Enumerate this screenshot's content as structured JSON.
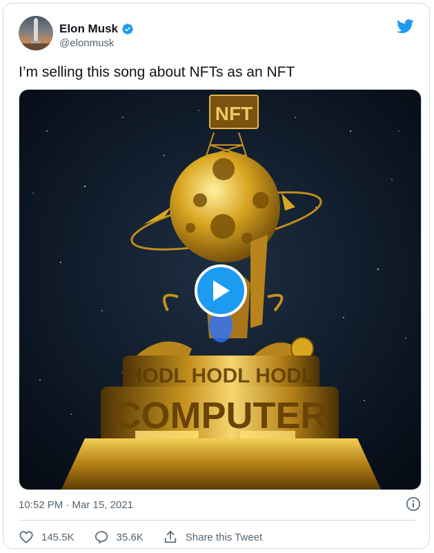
{
  "tweet": {
    "author_name": "Elon Musk",
    "handle": "@elonmusk",
    "text": "I’m selling this song about NFTs as an NFT",
    "timestamp": "10:52 PM · Mar 15, 2021"
  },
  "media": {
    "sign_text": "NFT",
    "ring_upper_text": "HODL HODL HODL",
    "ring_lower_text": "COMPUTER"
  },
  "actions": {
    "likes": "145.5K",
    "replies": "35.6K",
    "share_label": "Share this Tweet"
  },
  "icons": {
    "verified": "verified-badge-icon",
    "brand": "twitter-bird-icon",
    "info": "info-icon",
    "like": "heart-icon",
    "reply": "comment-icon",
    "share": "share-icon",
    "play": "play-icon"
  },
  "colors": {
    "brand_blue": "#1d9bf0",
    "text": "#0f1419",
    "muted": "#536471",
    "border": "#cfd9de",
    "gold": "#d8a820"
  }
}
